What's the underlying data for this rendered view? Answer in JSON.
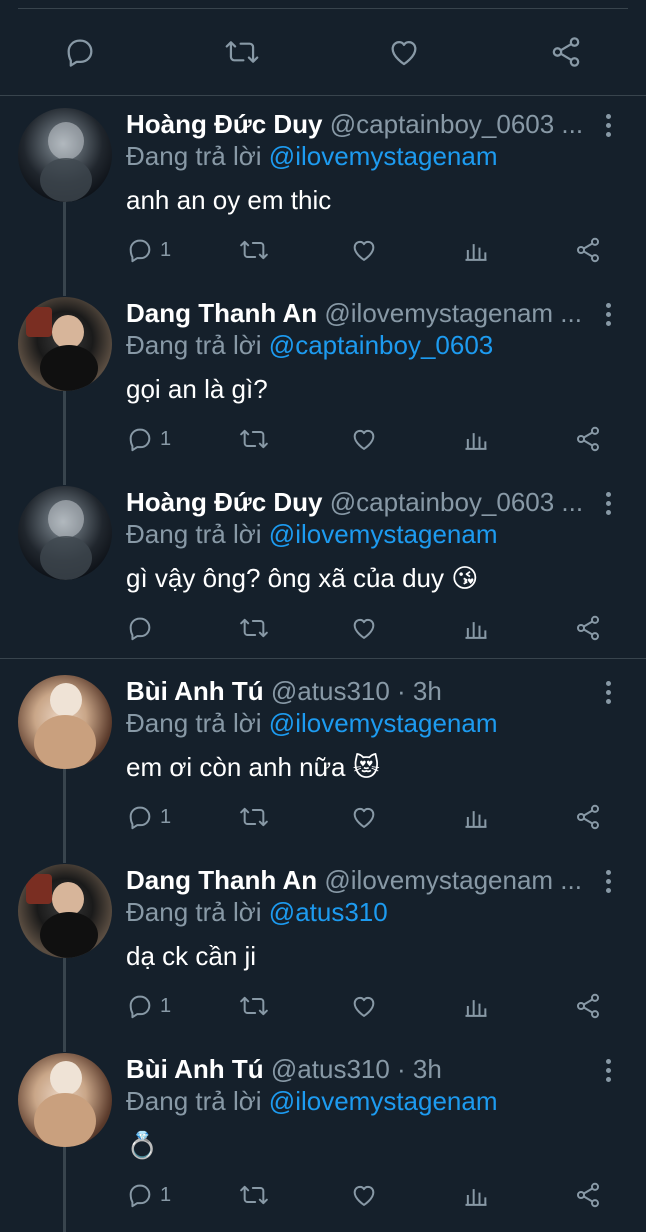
{
  "colors": {
    "background": "#15202b",
    "divider": "#38444d",
    "muted": "#8899a6",
    "mention": "#1d9bf0",
    "text": "#ffffff"
  },
  "top_actions": [
    "reply-icon",
    "retweet-icon",
    "like-icon",
    "share-icon"
  ],
  "tweets": [
    {
      "name": "Hoàng Đức Duy",
      "handle": "@captainboy_0603 ...",
      "replying_label": "Đang trả lời",
      "replying_to": "@ilovemystagenam",
      "text": "anh an oy em thic",
      "reply_count": "1",
      "avatar": "duy"
    },
    {
      "name": "Dang Thanh An",
      "handle": "@ilovemystagenam ...",
      "replying_label": "Đang trả lời",
      "replying_to": "@captainboy_0603",
      "text": "gọi an là gì?",
      "reply_count": "1",
      "avatar": "an"
    },
    {
      "name": "Hoàng Đức Duy",
      "handle": "@captainboy_0603 ...",
      "replying_label": "Đang trả lời",
      "replying_to": "@ilovemystagenam",
      "text": "gì vậy ông? ông xã của duy 😘",
      "reply_count": "",
      "avatar": "duy"
    },
    {
      "name": "Bùi Anh Tú",
      "handle": "@atus310 · 3h",
      "replying_label": "Đang trả lời",
      "replying_to": "@ilovemystagenam",
      "text": "em ơi còn anh nữa 😻",
      "reply_count": "1",
      "avatar": "tu"
    },
    {
      "name": "Dang Thanh An",
      "handle": "@ilovemystagenam ...",
      "replying_label": "Đang trả lời",
      "replying_to": "@atus310",
      "text": "dạ ck cần ji",
      "reply_count": "1",
      "avatar": "an"
    },
    {
      "name": "Bùi Anh Tú",
      "handle": "@atus310 · 3h",
      "replying_label": "Đang trả lời",
      "replying_to": "@ilovemystagenam",
      "text": "💍",
      "reply_count": "1",
      "avatar": "tu"
    }
  ]
}
